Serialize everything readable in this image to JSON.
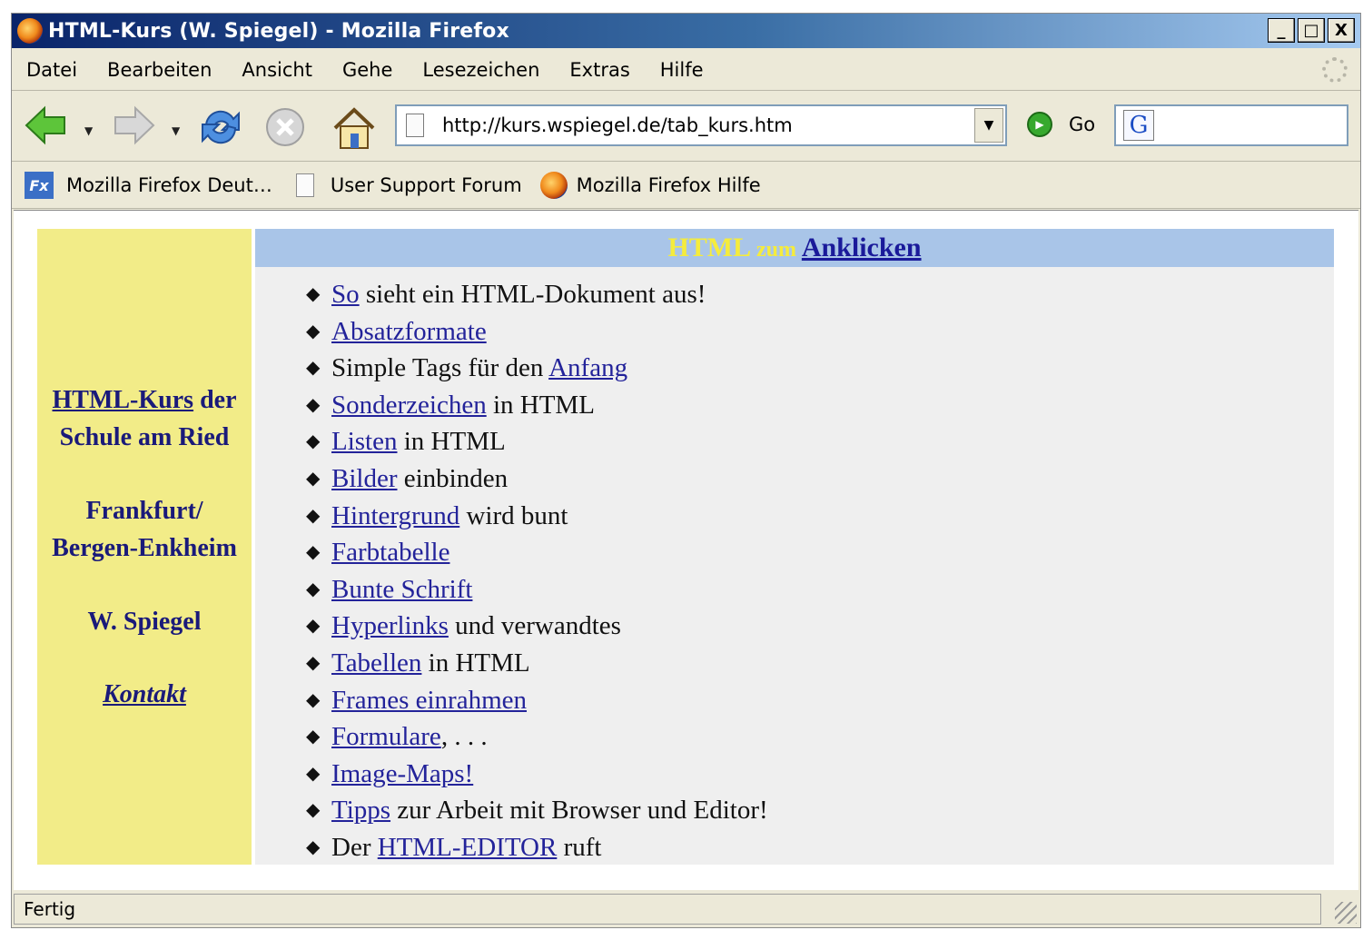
{
  "window": {
    "title": "HTML-Kurs (W. Spiegel) - Mozilla Firefox",
    "controls": {
      "minimize": "_",
      "maximize": "□",
      "close": "X"
    }
  },
  "menu": [
    "Datei",
    "Bearbeiten",
    "Ansicht",
    "Gehe",
    "Lesezeichen",
    "Extras",
    "Hilfe"
  ],
  "toolbar": {
    "url": "http://kurs.wspiegel.de/tab_kurs.htm",
    "go_label": "Go",
    "search_engine_glyph": "G",
    "icons": [
      "back-arrow-icon",
      "forward-arrow-icon",
      "reload-icon",
      "stop-icon",
      "home-icon",
      "go-icon"
    ]
  },
  "bookmarks": [
    "Mozilla Firefox Deut…",
    "User Support Forum",
    "Mozilla Firefox Hilfe"
  ],
  "sidebar": {
    "course_link": "HTML-Kurs",
    "course_rest": " der",
    "school": "Schule am Ried",
    "city_1": "Frankfurt/",
    "city_2": "Bergen-Enkheim",
    "author": "W. Spiegel",
    "contact": "Kontakt"
  },
  "main": {
    "header": {
      "part1": "HTML",
      "part2": "zum",
      "link": "Anklicken"
    },
    "items": [
      {
        "pre": "",
        "link": "So",
        "post": " sieht ein HTML-Dokument aus!"
      },
      {
        "pre": "",
        "link": "Absatzformate",
        "post": ""
      },
      {
        "pre": "Simple Tags für den ",
        "link": "Anfang",
        "post": ""
      },
      {
        "pre": "",
        "link": "Sonderzeichen",
        "post": " in HTML"
      },
      {
        "pre": "",
        "link": "Listen",
        "post": " in HTML"
      },
      {
        "pre": "",
        "link": "Bilder",
        "post": " einbinden"
      },
      {
        "pre": "",
        "link": "Hintergrund",
        "post": " wird bunt"
      },
      {
        "pre": "",
        "link": "Farbtabelle",
        "post": ""
      },
      {
        "pre": "",
        "link": "Bunte Schrift",
        "post": ""
      },
      {
        "pre": "",
        "link": "Hyperlinks",
        "post": " und verwandtes"
      },
      {
        "pre": "",
        "link": "Tabellen",
        "post": " in HTML"
      },
      {
        "pre": "",
        "link": "Frames einrahmen",
        "post": ""
      },
      {
        "pre": "",
        "link": "Formulare",
        "post": ", . . ."
      },
      {
        "pre": "",
        "link": "Image-Maps!",
        "post": ""
      },
      {
        "pre": "",
        "link": "Tipps",
        "post": " zur Arbeit mit Browser und Editor!"
      },
      {
        "pre": "Der ",
        "link": "HTML-EDITOR",
        "post": " ruft"
      }
    ]
  },
  "status": {
    "text": "Fertig"
  },
  "colors": {
    "sidebar_bg": "#f2ec88",
    "header_bg": "#a9c5e8",
    "link": "#23239a",
    "header_highlight": "#f5ec3c"
  }
}
